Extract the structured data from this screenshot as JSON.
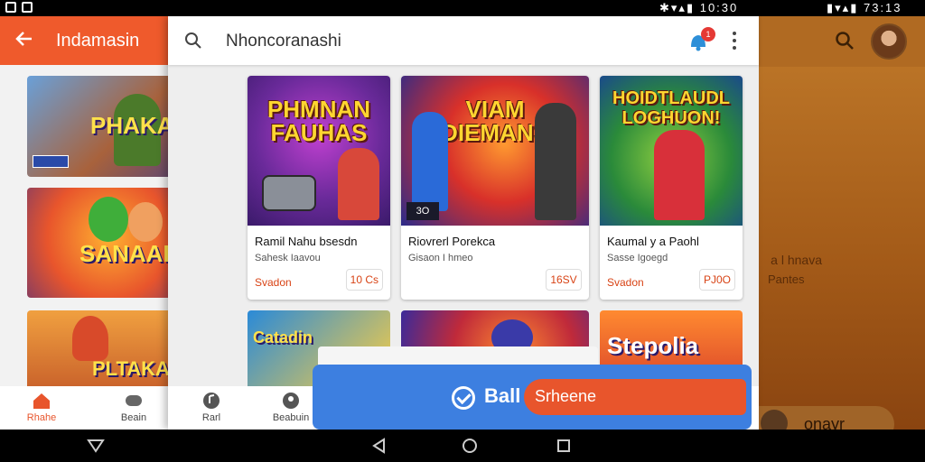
{
  "status_bar": {
    "center_time": "10:30",
    "right_time": "73:13"
  },
  "left_app": {
    "title": "Indamasin",
    "tiles": [
      {
        "label": "PHAKAI"
      },
      {
        "label": "SANAAI"
      },
      {
        "label": "PLTAKAN"
      }
    ],
    "nav": [
      {
        "label": "Rhahe"
      },
      {
        "label": "Beain"
      }
    ]
  },
  "center_app": {
    "search_query": "Nhoncoranashi",
    "notification_count": "1",
    "cards": [
      {
        "art_title": "PHMNAN FAUHAS",
        "name": "Ramil Nahu bsesdn",
        "subtitle": "Sahesk Iaavou",
        "tag": "Svadon",
        "price": "10 Cs"
      },
      {
        "art_title": "VIAM DIEMANS",
        "name": "Riovrerl Porekca",
        "subtitle": "Gisaon I hmeo",
        "tag": "",
        "price": "16SV"
      },
      {
        "art_title": "HOIDTLAUDL LOGHUON!",
        "name": "Kaumal y a Paohl",
        "subtitle": "Sasse Igoegd",
        "tag": "Svadon",
        "price": "PJ0O"
      }
    ],
    "bottom_tiles": [
      {
        "label": "Catadin"
      },
      {
        "label": ""
      },
      {
        "label": "Stepolia"
      }
    ],
    "nav": [
      {
        "label": "Rarl"
      },
      {
        "label": "Beabuin"
      }
    ]
  },
  "action_bar": {
    "ball_label": "Ball",
    "button_label": "Srheene"
  },
  "right_app": {
    "text1": "a l hnava",
    "text2": "Pantes",
    "pill_label": "onayr"
  }
}
